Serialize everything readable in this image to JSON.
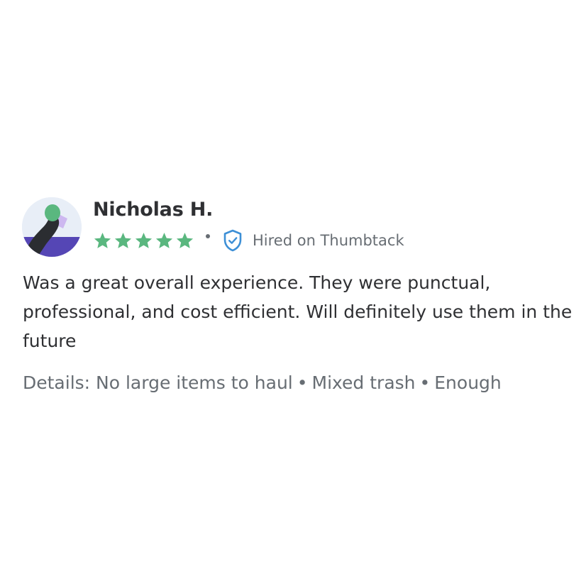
{
  "review": {
    "reviewer_name": "Nicholas H.",
    "rating": 5,
    "rating_max": 5,
    "star_color": "#5ab77f",
    "hired_label": "Hired on Thumbtack",
    "shield_color": "#3d8fd6",
    "avatar_icon": "person-silhouette-avatar",
    "text": "Was a great overall experience. They were punctual, professional, and cost efficient. Will definitely use them in the future",
    "details_label": "Details:",
    "details_items": [
      "No large items to haul",
      "Mixed trash",
      "Enough"
    ]
  }
}
